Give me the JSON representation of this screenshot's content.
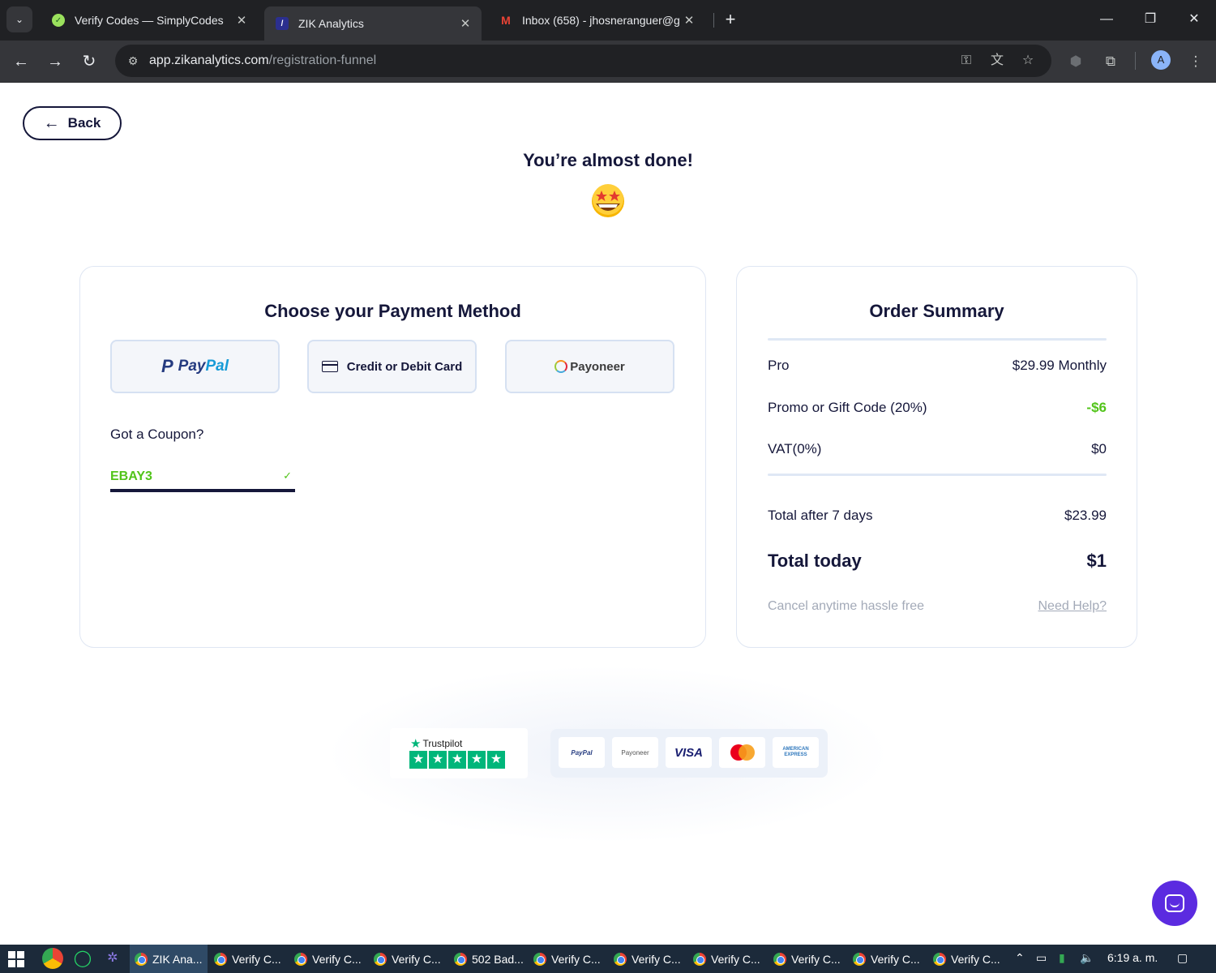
{
  "browser": {
    "tabs": [
      {
        "title": "Verify Codes — SimplyCodes",
        "active": false
      },
      {
        "title": "ZIK Analytics",
        "active": true
      },
      {
        "title": "Inbox (658) - jhosneranguer@g",
        "active": false
      }
    ],
    "url_host": "app.zikanalytics.com",
    "url_path": "/registration-funnel",
    "profile_initial": "A"
  },
  "page": {
    "back_label": "Back",
    "headline": "You’re almost done!",
    "payment": {
      "title": "Choose your Payment Method",
      "methods": {
        "paypal_pay": "Pay",
        "paypal_pal": "Pal",
        "card": "Credit or Debit Card",
        "payoneer": "Payoneer"
      },
      "coupon_label": "Got a Coupon?",
      "coupon_value": "EBAY3"
    },
    "order": {
      "title": "Order Summary",
      "rows": [
        {
          "label": "Pro",
          "value": "$29.99 Monthly"
        },
        {
          "label": "Promo or Gift Code (20%)",
          "value": "-$6"
        },
        {
          "label": "VAT(0%)",
          "value": "$0"
        }
      ],
      "total_after_label": "Total after 7 days",
      "total_after_value": "$23.99",
      "total_today_label": "Total today",
      "total_today_value": "$1",
      "cancel_text": "Cancel anytime hassle free",
      "help_link": "Need Help?"
    },
    "trust": {
      "trustpilot_label": "Trustpilot",
      "rating_stars": 5,
      "logos": [
        "PayPal",
        "Payoneer",
        "VISA",
        "MasterCard",
        "AMERICAN EXPRESS"
      ]
    }
  },
  "taskbar": {
    "tasks": [
      "ZIK Ana...",
      "Verify C...",
      "Verify C...",
      "Verify C...",
      "502 Bad...",
      "Verify C...",
      "Verify C...",
      "Verify C...",
      "Verify C...",
      "Verify C...",
      "Verify C..."
    ],
    "clock": "6:19 a. m."
  },
  "colors": {
    "navy": "#15173a",
    "green": "#52c41a",
    "paypal_dark": "#253b80",
    "paypal_light": "#179bd7",
    "chat_purple": "#5b2be0",
    "trustpilot_green": "#00b67a"
  }
}
